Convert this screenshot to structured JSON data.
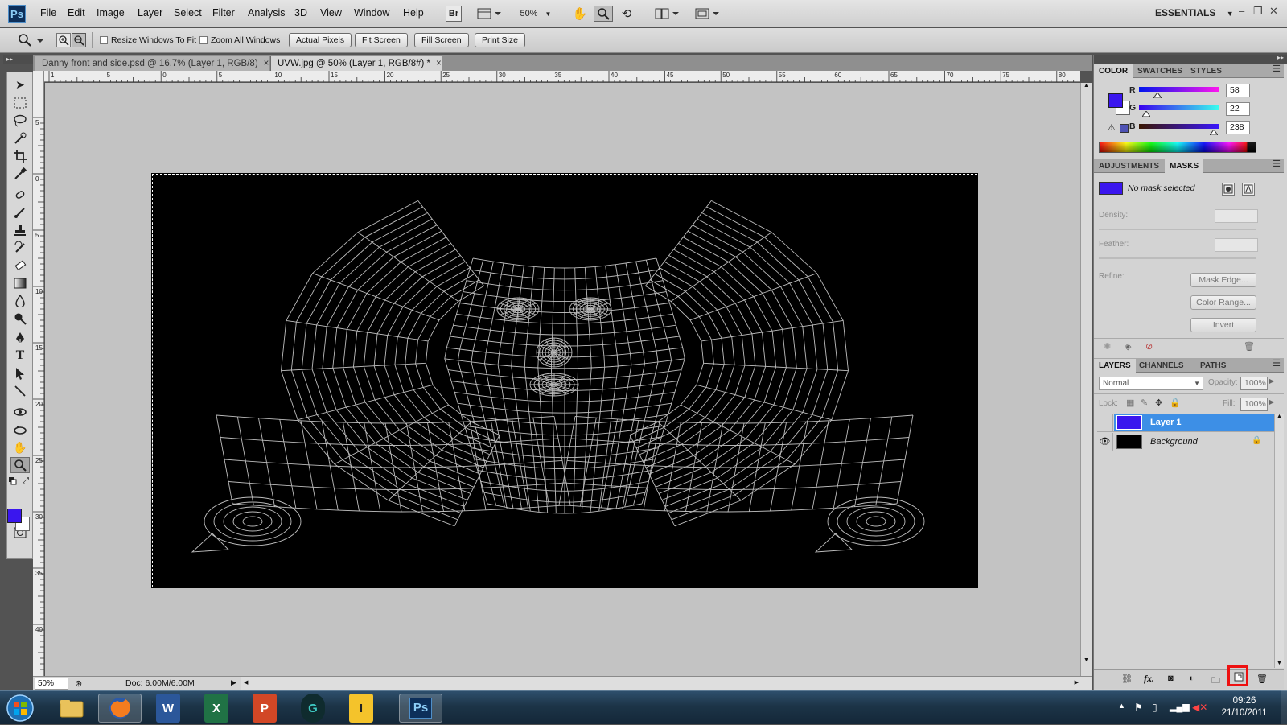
{
  "app": {
    "logo": "Ps",
    "workspace": "ESSENTIALS"
  },
  "menu": [
    "File",
    "Edit",
    "Image",
    "Layer",
    "Select",
    "Filter",
    "Analysis",
    "3D",
    "View",
    "Window",
    "Help"
  ],
  "menubar_widgets": {
    "bridge": "Br",
    "zoom_level": "50%"
  },
  "options_bar": {
    "resize_windows": "Resize Windows To Fit",
    "zoom_all": "Zoom All Windows",
    "actual_pixels": "Actual Pixels",
    "fit_screen": "Fit Screen",
    "fill_screen": "Fill Screen",
    "print_size": "Print Size"
  },
  "tabs": [
    {
      "label": "Danny front and side.psd @ 16.7% (Layer 1, RGB/8)",
      "close": "×"
    },
    {
      "label": "UVW.jpg @ 50% (Layer 1, RGB/8#) *",
      "close": "×"
    }
  ],
  "ruler_h_labels": [
    "1",
    "5",
    "0",
    "5",
    "10",
    "15",
    "20",
    "25",
    "30",
    "35",
    "40",
    "45",
    "50",
    "55",
    "60",
    "65",
    "70",
    "75",
    "80"
  ],
  "ruler_v_labels": [
    "5",
    "0",
    "5",
    "10",
    "15",
    "20",
    "25",
    "30",
    "35",
    "40"
  ],
  "status": {
    "zoom": "50%",
    "doc": "Doc: 6.00M/6.00M"
  },
  "color_panel": {
    "tabs": [
      "COLOR",
      "SWATCHES",
      "STYLES"
    ],
    "r_label": "R",
    "g_label": "G",
    "b_label": "B",
    "r": "58",
    "g": "22",
    "b": "238",
    "r_level": 58,
    "g_level": 22,
    "b_level": 238,
    "foreground_color": "#3a16ee"
  },
  "masks_panel": {
    "tabs": [
      "ADJUSTMENTS",
      "MASKS"
    ],
    "status": "No mask selected",
    "density": "Density:",
    "feather": "Feather:",
    "refine": "Refine:",
    "mask_edge": "Mask Edge...",
    "color_range": "Color Range...",
    "invert": "Invert"
  },
  "layers_panel": {
    "tabs": [
      "LAYERS",
      "CHANNELS",
      "PATHS"
    ],
    "blend_mode": "Normal",
    "opacity_label": "Opacity:",
    "opacity": "100%",
    "lock_label": "Lock:",
    "fill_label": "Fill:",
    "fill": "100%",
    "layers": [
      {
        "name": "Layer 1",
        "selected": true
      },
      {
        "name": "Background",
        "selected": false
      }
    ]
  },
  "taskbar": {
    "apps": [
      "W",
      "X",
      "P",
      "G",
      "I",
      "Ps"
    ],
    "time": "09:26",
    "date": "21/10/2011"
  }
}
